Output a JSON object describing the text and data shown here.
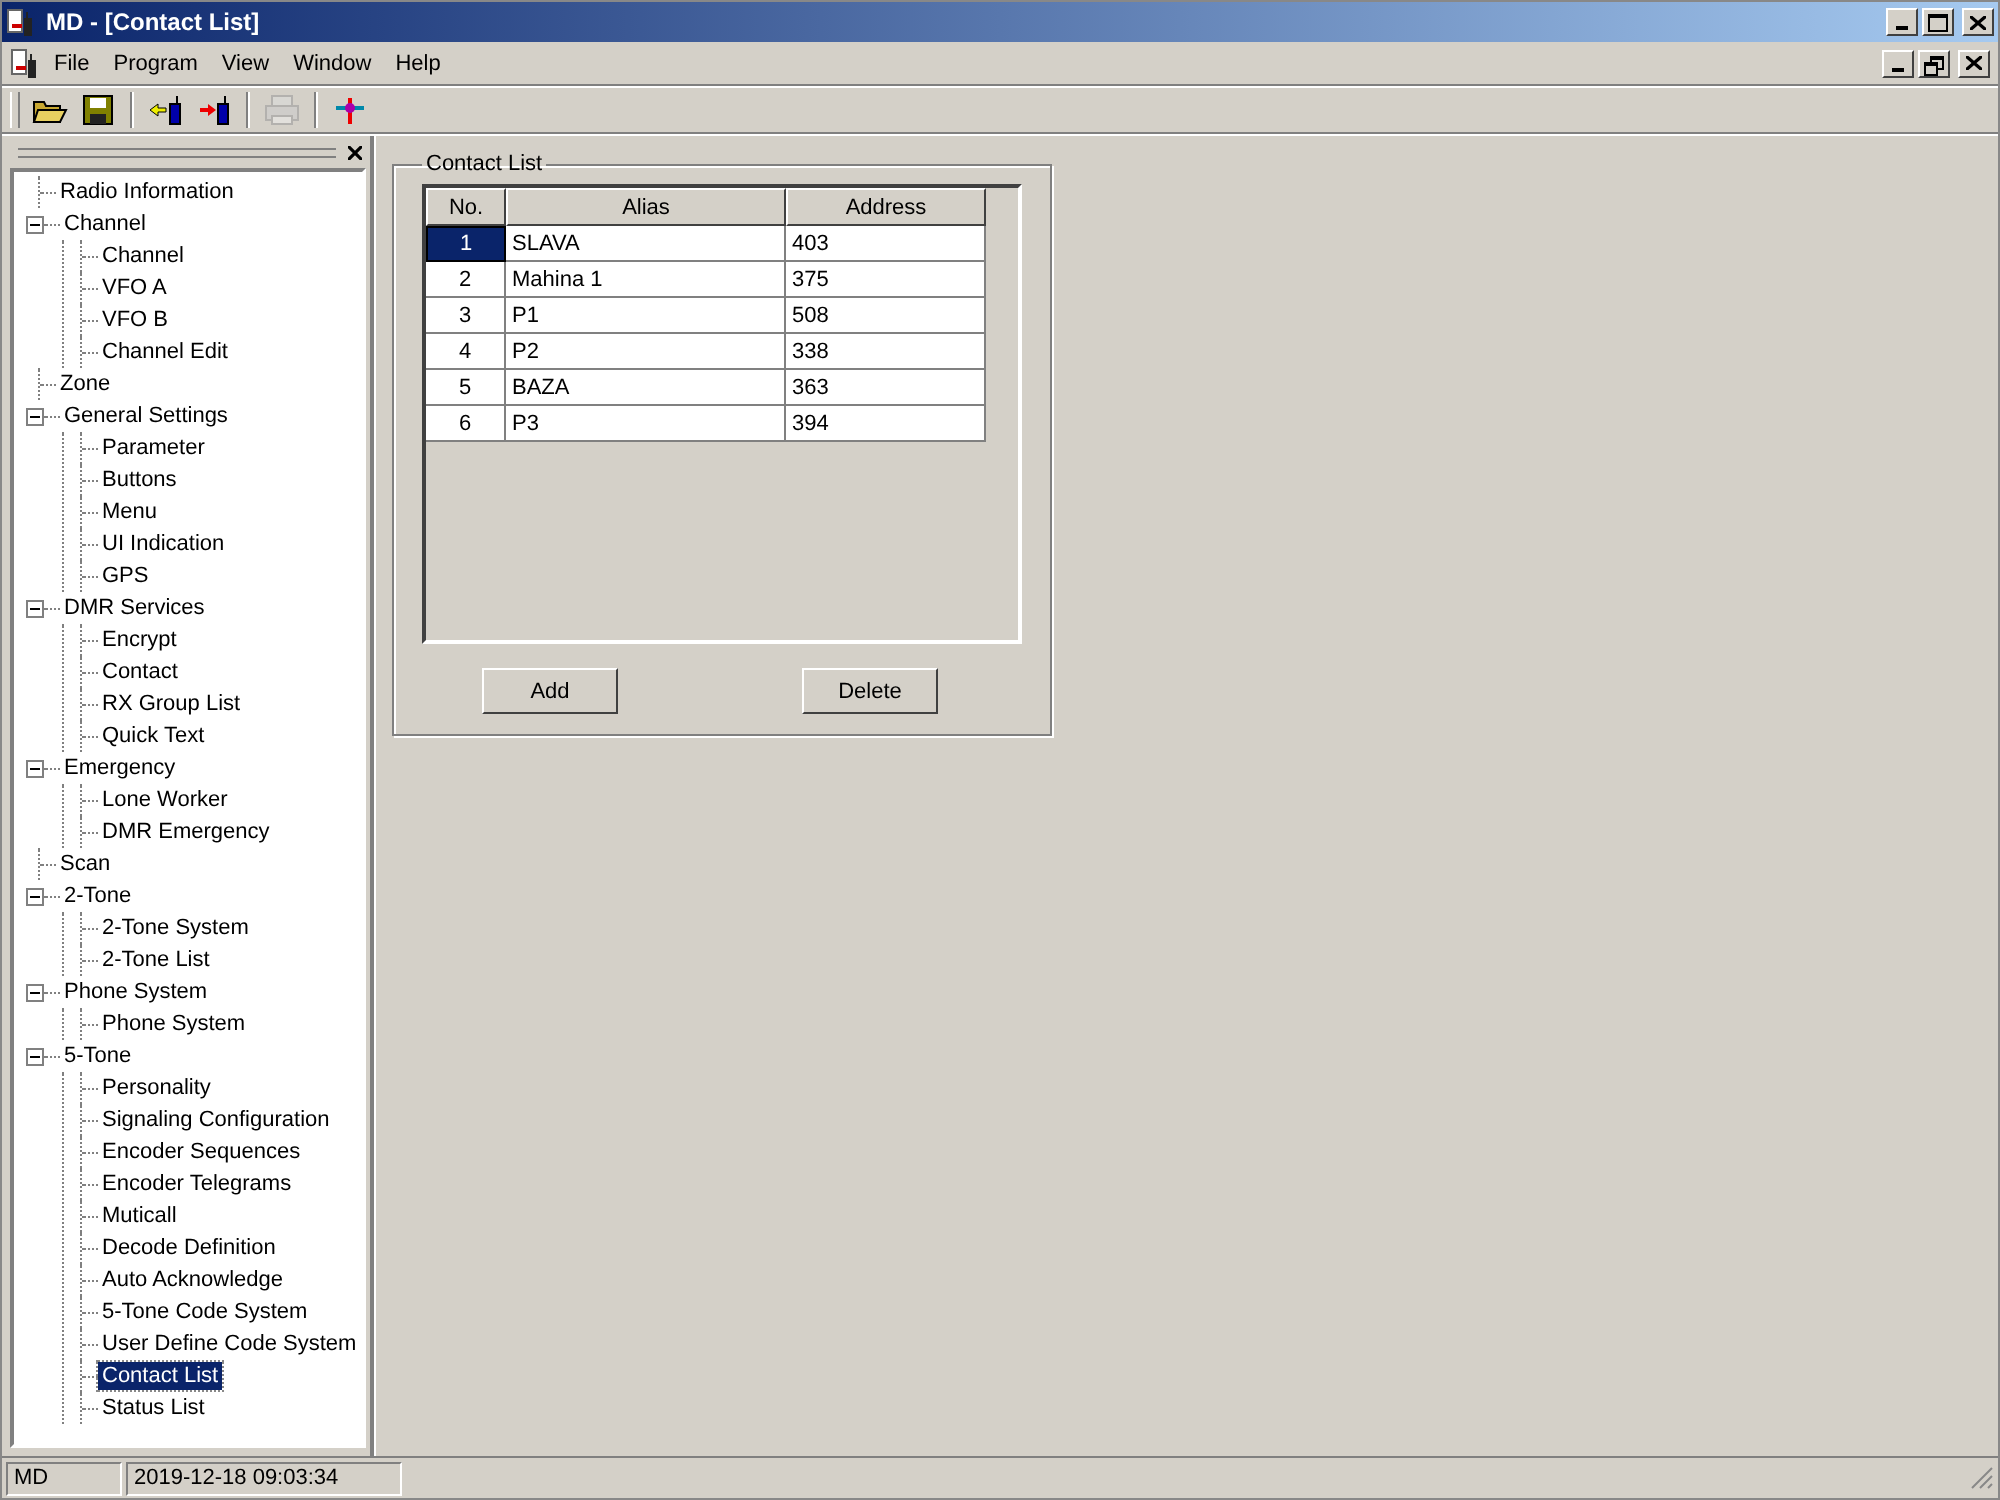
{
  "window": {
    "title": "MD - [Contact List]"
  },
  "menu": [
    "File",
    "Program",
    "View",
    "Window",
    "Help"
  ],
  "toolbar": [
    {
      "kind": "open",
      "disabled": false
    },
    {
      "kind": "save",
      "disabled": false
    },
    {
      "kind": "sep"
    },
    {
      "kind": "read",
      "disabled": false
    },
    {
      "kind": "write",
      "disabled": false
    },
    {
      "kind": "sep"
    },
    {
      "kind": "print",
      "disabled": true
    },
    {
      "kind": "sep"
    },
    {
      "kind": "tool",
      "disabled": false
    }
  ],
  "tree": [
    {
      "label": "Radio Information",
      "selected": false
    },
    {
      "label": "Channel",
      "selected": false,
      "expanded": true,
      "children": [
        {
          "label": "Channel",
          "selected": false
        },
        {
          "label": "VFO A",
          "selected": false
        },
        {
          "label": "VFO B",
          "selected": false
        },
        {
          "label": "Channel Edit",
          "selected": false
        }
      ]
    },
    {
      "label": "Zone",
      "selected": false
    },
    {
      "label": "General Settings",
      "selected": false,
      "expanded": true,
      "children": [
        {
          "label": "Parameter",
          "selected": false
        },
        {
          "label": "Buttons",
          "selected": false
        },
        {
          "label": "Menu",
          "selected": false
        },
        {
          "label": "UI Indication",
          "selected": false
        },
        {
          "label": "GPS",
          "selected": false
        }
      ]
    },
    {
      "label": "DMR Services",
      "selected": false,
      "expanded": true,
      "children": [
        {
          "label": "Encrypt",
          "selected": false
        },
        {
          "label": "Contact",
          "selected": false
        },
        {
          "label": "RX Group List",
          "selected": false
        },
        {
          "label": "Quick Text",
          "selected": false
        }
      ]
    },
    {
      "label": "Emergency",
      "selected": false,
      "expanded": true,
      "children": [
        {
          "label": "Lone Worker",
          "selected": false
        },
        {
          "label": "DMR Emergency",
          "selected": false
        }
      ]
    },
    {
      "label": "Scan",
      "selected": false
    },
    {
      "label": "2-Tone",
      "selected": false,
      "expanded": true,
      "children": [
        {
          "label": "2-Tone System",
          "selected": false
        },
        {
          "label": "2-Tone List",
          "selected": false
        }
      ]
    },
    {
      "label": "Phone System",
      "selected": false,
      "expanded": true,
      "children": [
        {
          "label": "Phone System",
          "selected": false
        }
      ]
    },
    {
      "label": "5-Tone",
      "selected": false,
      "expanded": true,
      "children": [
        {
          "label": "Personality",
          "selected": false
        },
        {
          "label": "Signaling Configuration",
          "selected": false
        },
        {
          "label": "Encoder Sequences",
          "selected": false
        },
        {
          "label": "Encoder Telegrams",
          "selected": false
        },
        {
          "label": "Muticall",
          "selected": false
        },
        {
          "label": "Decode Definition",
          "selected": false
        },
        {
          "label": "Auto Acknowledge",
          "selected": false
        },
        {
          "label": "5-Tone Code System",
          "selected": false
        },
        {
          "label": "User Define Code System",
          "selected": false
        },
        {
          "label": "Contact List",
          "selected": true
        },
        {
          "label": "Status List",
          "selected": false
        }
      ]
    }
  ],
  "panel": {
    "title": "Contact List",
    "columns": [
      "No.",
      "Alias",
      "Address"
    ],
    "rows": [
      {
        "no": "1",
        "alias": "SLAVA",
        "address": "403",
        "selected": true
      },
      {
        "no": "2",
        "alias": "Mahina 1",
        "address": "375",
        "selected": false
      },
      {
        "no": "3",
        "alias": "P1",
        "address": "508",
        "selected": false
      },
      {
        "no": "4",
        "alias": "P2",
        "address": "338",
        "selected": false
      },
      {
        "no": "5",
        "alias": "BAZA",
        "address": "363",
        "selected": false
      },
      {
        "no": "6",
        "alias": "P3",
        "address": "394",
        "selected": false
      }
    ],
    "buttons": [
      "Add",
      "Delete"
    ]
  },
  "status_bar": [
    "MD",
    "2019-12-18 09:03:34"
  ]
}
